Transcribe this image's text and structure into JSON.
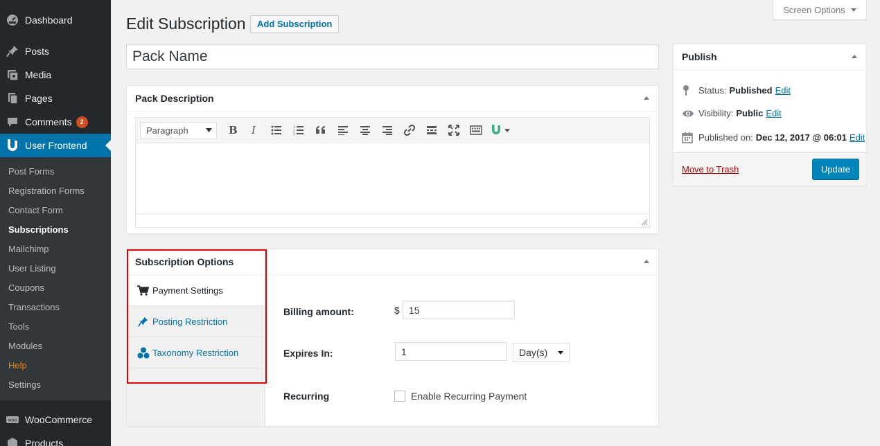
{
  "sidebar": {
    "top_items": [
      {
        "label": "Dashboard",
        "icon": "dashboard-icon"
      },
      {
        "label": "Posts",
        "icon": "pin-icon"
      },
      {
        "label": "Media",
        "icon": "media-icon"
      },
      {
        "label": "Pages",
        "icon": "pages-icon"
      },
      {
        "label": "Comments",
        "icon": "comment-icon",
        "badge": "2"
      },
      {
        "label": "User Frontend",
        "icon": "user-frontend-icon"
      }
    ],
    "submenu": [
      "Post Forms",
      "Registration Forms",
      "Contact Form",
      "Subscriptions",
      "Mailchimp",
      "User Listing",
      "Coupons",
      "Transactions",
      "Tools",
      "Modules",
      "Help",
      "Settings"
    ],
    "bottom_items": [
      {
        "label": "WooCommerce",
        "icon": "woocommerce-icon"
      },
      {
        "label": "Products",
        "icon": "products-icon"
      }
    ]
  },
  "header": {
    "title": "Edit Subscription",
    "add_button": "Add Subscription",
    "screen_options": "Screen Options"
  },
  "title_field": {
    "value": "Pack Name"
  },
  "description_box": {
    "title": "Pack Description",
    "format_select": "Paragraph",
    "toolbar_icons": [
      "bold-icon",
      "italic-icon",
      "bullet-list-icon",
      "numbered-list-icon",
      "blockquote-icon",
      "align-left-icon",
      "align-center-icon",
      "align-right-icon",
      "link-icon",
      "read-more-icon",
      "fullscreen-icon",
      "toolbar-toggle-icon",
      "wpuf-shortcode-icon"
    ]
  },
  "subscription_options": {
    "title": "Subscription Options",
    "tabs": [
      {
        "label": "Payment Settings",
        "icon": "cart-icon"
      },
      {
        "label": "Posting Restriction",
        "icon": "pin-icon"
      },
      {
        "label": "Taxonomy Restriction",
        "icon": "taxonomy-icon"
      }
    ],
    "billing_label": "Billing amount:",
    "currency": "$",
    "billing_value": "15",
    "expires_label": "Expires In:",
    "expires_value": "1",
    "expires_unit": "Day(s)",
    "recurring_label": "Recurring",
    "recurring_checkbox_label": "Enable Recurring Payment",
    "recurring_checked": false
  },
  "publish": {
    "title": "Publish",
    "status_label": "Status:",
    "status_value": "Published",
    "visibility_label": "Visibility:",
    "visibility_value": "Public",
    "published_label": "Published on:",
    "published_value": "Dec 12, 2017 @ 06:01",
    "edit_label": "Edit",
    "trash_label": "Move to Trash",
    "update_label": "Update"
  },
  "colors": {
    "sidebar_bg": "#23282d",
    "accent": "#0073aa",
    "button_primary": "#0085ba",
    "highlight_box": "#e00000",
    "help_link": "#f18500",
    "trash": "#aa0000"
  }
}
